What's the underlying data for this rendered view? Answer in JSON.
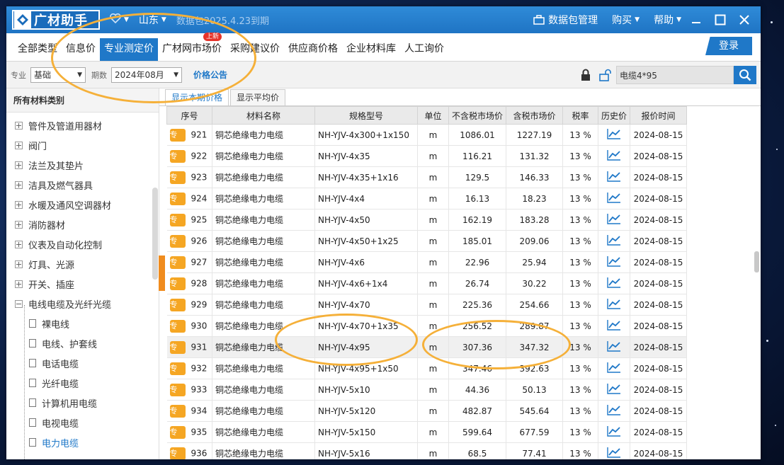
{
  "app": {
    "logo_text": "广材助手",
    "region": "山东",
    "package_status": "数据包2025.4.23到期",
    "toolbar": {
      "package_manage": "数据包管理",
      "buy": "购买",
      "help": "帮助"
    }
  },
  "tabs": [
    {
      "label": "全部类型",
      "active": false
    },
    {
      "label": "信息价",
      "active": false
    },
    {
      "label": "专业测定价",
      "active": true
    },
    {
      "label": "广材网市场价",
      "active": false,
      "badge": "上新"
    },
    {
      "label": "采购建议价",
      "active": false
    },
    {
      "label": "供应商价格",
      "active": false
    },
    {
      "label": "企业材料库",
      "active": false
    },
    {
      "label": "人工询价",
      "active": false
    }
  ],
  "login_label": "登录",
  "filters": {
    "major_label": "专业",
    "major_value": "基础",
    "period_label": "期数",
    "period_value": "2024年08月",
    "price_notice": "价格公告",
    "search_value": "电缆4*95"
  },
  "sidebar": {
    "title": "所有材料类别",
    "items": [
      {
        "label": "管件及管道用器材",
        "type": "group",
        "expanded": false
      },
      {
        "label": "阀门",
        "type": "group",
        "expanded": false
      },
      {
        "label": "法兰及其垫片",
        "type": "group",
        "expanded": false
      },
      {
        "label": "洁具及燃气器具",
        "type": "group",
        "expanded": false
      },
      {
        "label": "水暖及通风空调器材",
        "type": "group",
        "expanded": false
      },
      {
        "label": "消防器材",
        "type": "group",
        "expanded": false
      },
      {
        "label": "仪表及自动化控制",
        "type": "group",
        "expanded": false
      },
      {
        "label": "灯具、光源",
        "type": "group",
        "expanded": false
      },
      {
        "label": "开关、插座",
        "type": "group",
        "expanded": false
      },
      {
        "label": "电线电缆及光纤光缆",
        "type": "group",
        "expanded": true
      },
      {
        "label": "裸电线",
        "type": "leaf"
      },
      {
        "label": "电线、护套线",
        "type": "leaf"
      },
      {
        "label": "电话电缆",
        "type": "leaf"
      },
      {
        "label": "光纤电缆",
        "type": "leaf"
      },
      {
        "label": "计算机用电缆",
        "type": "leaf"
      },
      {
        "label": "电视电缆",
        "type": "leaf"
      },
      {
        "label": "电力电缆",
        "type": "leaf",
        "selected": true
      }
    ]
  },
  "subtabs": [
    "显示本期价格",
    "显示平均价"
  ],
  "table": {
    "headers": [
      "序号",
      "材料名称",
      "规格型号",
      "单位",
      "不含税市场价",
      "含税市场价",
      "税率",
      "历史价",
      "报价时间"
    ],
    "badge": "专",
    "rows": [
      [
        "921",
        "铜芯绝缘电力电缆",
        "NH-YJV-4x300+1x150",
        "m",
        "1086.01",
        "1227.19",
        "13 %",
        "2024-08-15"
      ],
      [
        "922",
        "铜芯绝缘电力电缆",
        "NH-YJV-4x35",
        "m",
        "116.21",
        "131.32",
        "13 %",
        "2024-08-15"
      ],
      [
        "923",
        "铜芯绝缘电力电缆",
        "NH-YJV-4x35+1x16",
        "m",
        "129.5",
        "146.33",
        "13 %",
        "2024-08-15"
      ],
      [
        "924",
        "铜芯绝缘电力电缆",
        "NH-YJV-4x4",
        "m",
        "16.13",
        "18.23",
        "13 %",
        "2024-08-15"
      ],
      [
        "925",
        "铜芯绝缘电力电缆",
        "NH-YJV-4x50",
        "m",
        "162.19",
        "183.28",
        "13 %",
        "2024-08-15"
      ],
      [
        "926",
        "铜芯绝缘电力电缆",
        "NH-YJV-4x50+1x25",
        "m",
        "185.01",
        "209.06",
        "13 %",
        "2024-08-15"
      ],
      [
        "927",
        "铜芯绝缘电力电缆",
        "NH-YJV-4x6",
        "m",
        "22.96",
        "25.94",
        "13 %",
        "2024-08-15"
      ],
      [
        "928",
        "铜芯绝缘电力电缆",
        "NH-YJV-4x6+1x4",
        "m",
        "26.74",
        "30.22",
        "13 %",
        "2024-08-15"
      ],
      [
        "929",
        "铜芯绝缘电力电缆",
        "NH-YJV-4x70",
        "m",
        "225.36",
        "254.66",
        "13 %",
        "2024-08-15"
      ],
      [
        "930",
        "铜芯绝缘电力电缆",
        "NH-YJV-4x70+1x35",
        "m",
        "256.52",
        "289.87",
        "13 %",
        "2024-08-15"
      ],
      [
        "931",
        "铜芯绝缘电力电缆",
        "NH-YJV-4x95",
        "m",
        "307.36",
        "347.32",
        "13 %",
        "2024-08-15"
      ],
      [
        "932",
        "铜芯绝缘电力电缆",
        "NH-YJV-4x95+1x50",
        "m",
        "347.46",
        "392.63",
        "13 %",
        "2024-08-15"
      ],
      [
        "933",
        "铜芯绝缘电力电缆",
        "NH-YJV-5x10",
        "m",
        "44.36",
        "50.13",
        "13 %",
        "2024-08-15"
      ],
      [
        "934",
        "铜芯绝缘电力电缆",
        "NH-YJV-5x120",
        "m",
        "482.87",
        "545.64",
        "13 %",
        "2024-08-15"
      ],
      [
        "935",
        "铜芯绝缘电力电缆",
        "NH-YJV-5x150",
        "m",
        "599.64",
        "677.59",
        "13 %",
        "2024-08-15"
      ],
      [
        "936",
        "铜芯绝缘电力电缆",
        "NH-YJV-5x16",
        "m",
        "68.5",
        "77.41",
        "13 %",
        "2024-08-15"
      ]
    ],
    "highlighted_row_index": 10
  },
  "colors": {
    "brand_blue": "#1f78c8",
    "badge_orange": "#f5a623",
    "annotation_orange": "#f5b039"
  }
}
